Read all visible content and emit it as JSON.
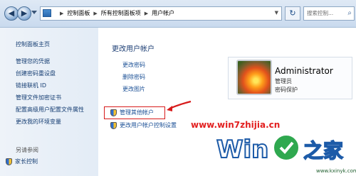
{
  "address_bar": {
    "crumbs": [
      "控制面板",
      "所有控制面板项",
      "用户帐户"
    ],
    "search_placeholder": "搜索控制..."
  },
  "sidebar": {
    "title": "控制面板主页",
    "items": [
      "管理您的凭据",
      "创建密码重设盘",
      "链接联机 ID",
      "管理文件加密证书",
      "配置高级用户配置文件属性",
      "更改我的环境变量"
    ],
    "see_also": "另请参阅",
    "family_link": "家长控制"
  },
  "main": {
    "heading": "更改用户帐户",
    "links": [
      "更改密码",
      "删除密码",
      "更改图片"
    ],
    "manage_other": "管理其他帐户",
    "uac_settings": "更改用户帐户控制设置"
  },
  "user": {
    "name": "Administrator",
    "role": "管理员",
    "password_status": "密码保护"
  },
  "watermark": {
    "url": "www.win7zhijia.cn",
    "logo_text": "Win7之家",
    "site": "www.kxinyk.com"
  }
}
